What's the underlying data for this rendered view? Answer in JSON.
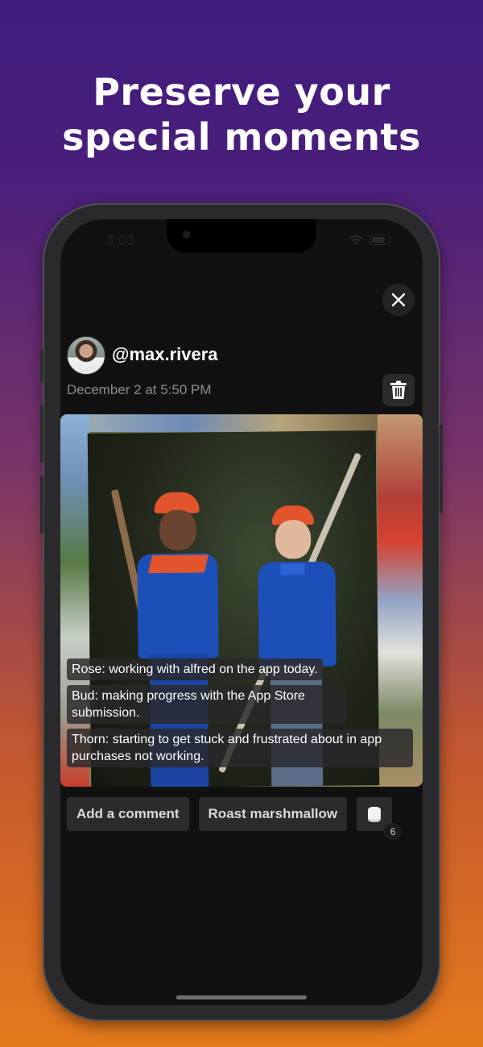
{
  "headline": {
    "line1": "Preserve your",
    "line2": "special moments"
  },
  "status_bar": {
    "time": "3:03"
  },
  "post": {
    "username": "@max.rivera",
    "date": "December 2 at 5:50 PM",
    "captions": [
      "Rose: working with alfred on the app today.",
      "Bud: making progress with the App Store submission.",
      "Thorn: starting to get stuck and frustrated about in app purchases not working."
    ]
  },
  "actions": {
    "add_comment": "Add a comment",
    "roast": "Roast marshmallow",
    "marshmallow_count": "6"
  },
  "icons": {
    "close": "close-icon",
    "trash": "trash-icon",
    "marshmallow": "marshmallow-icon"
  },
  "colors": {
    "gradient_top": "#3f1b7e",
    "gradient_bottom": "#e57a1c",
    "screen_bg": "#111112",
    "button_bg": "#2b2b2d"
  }
}
